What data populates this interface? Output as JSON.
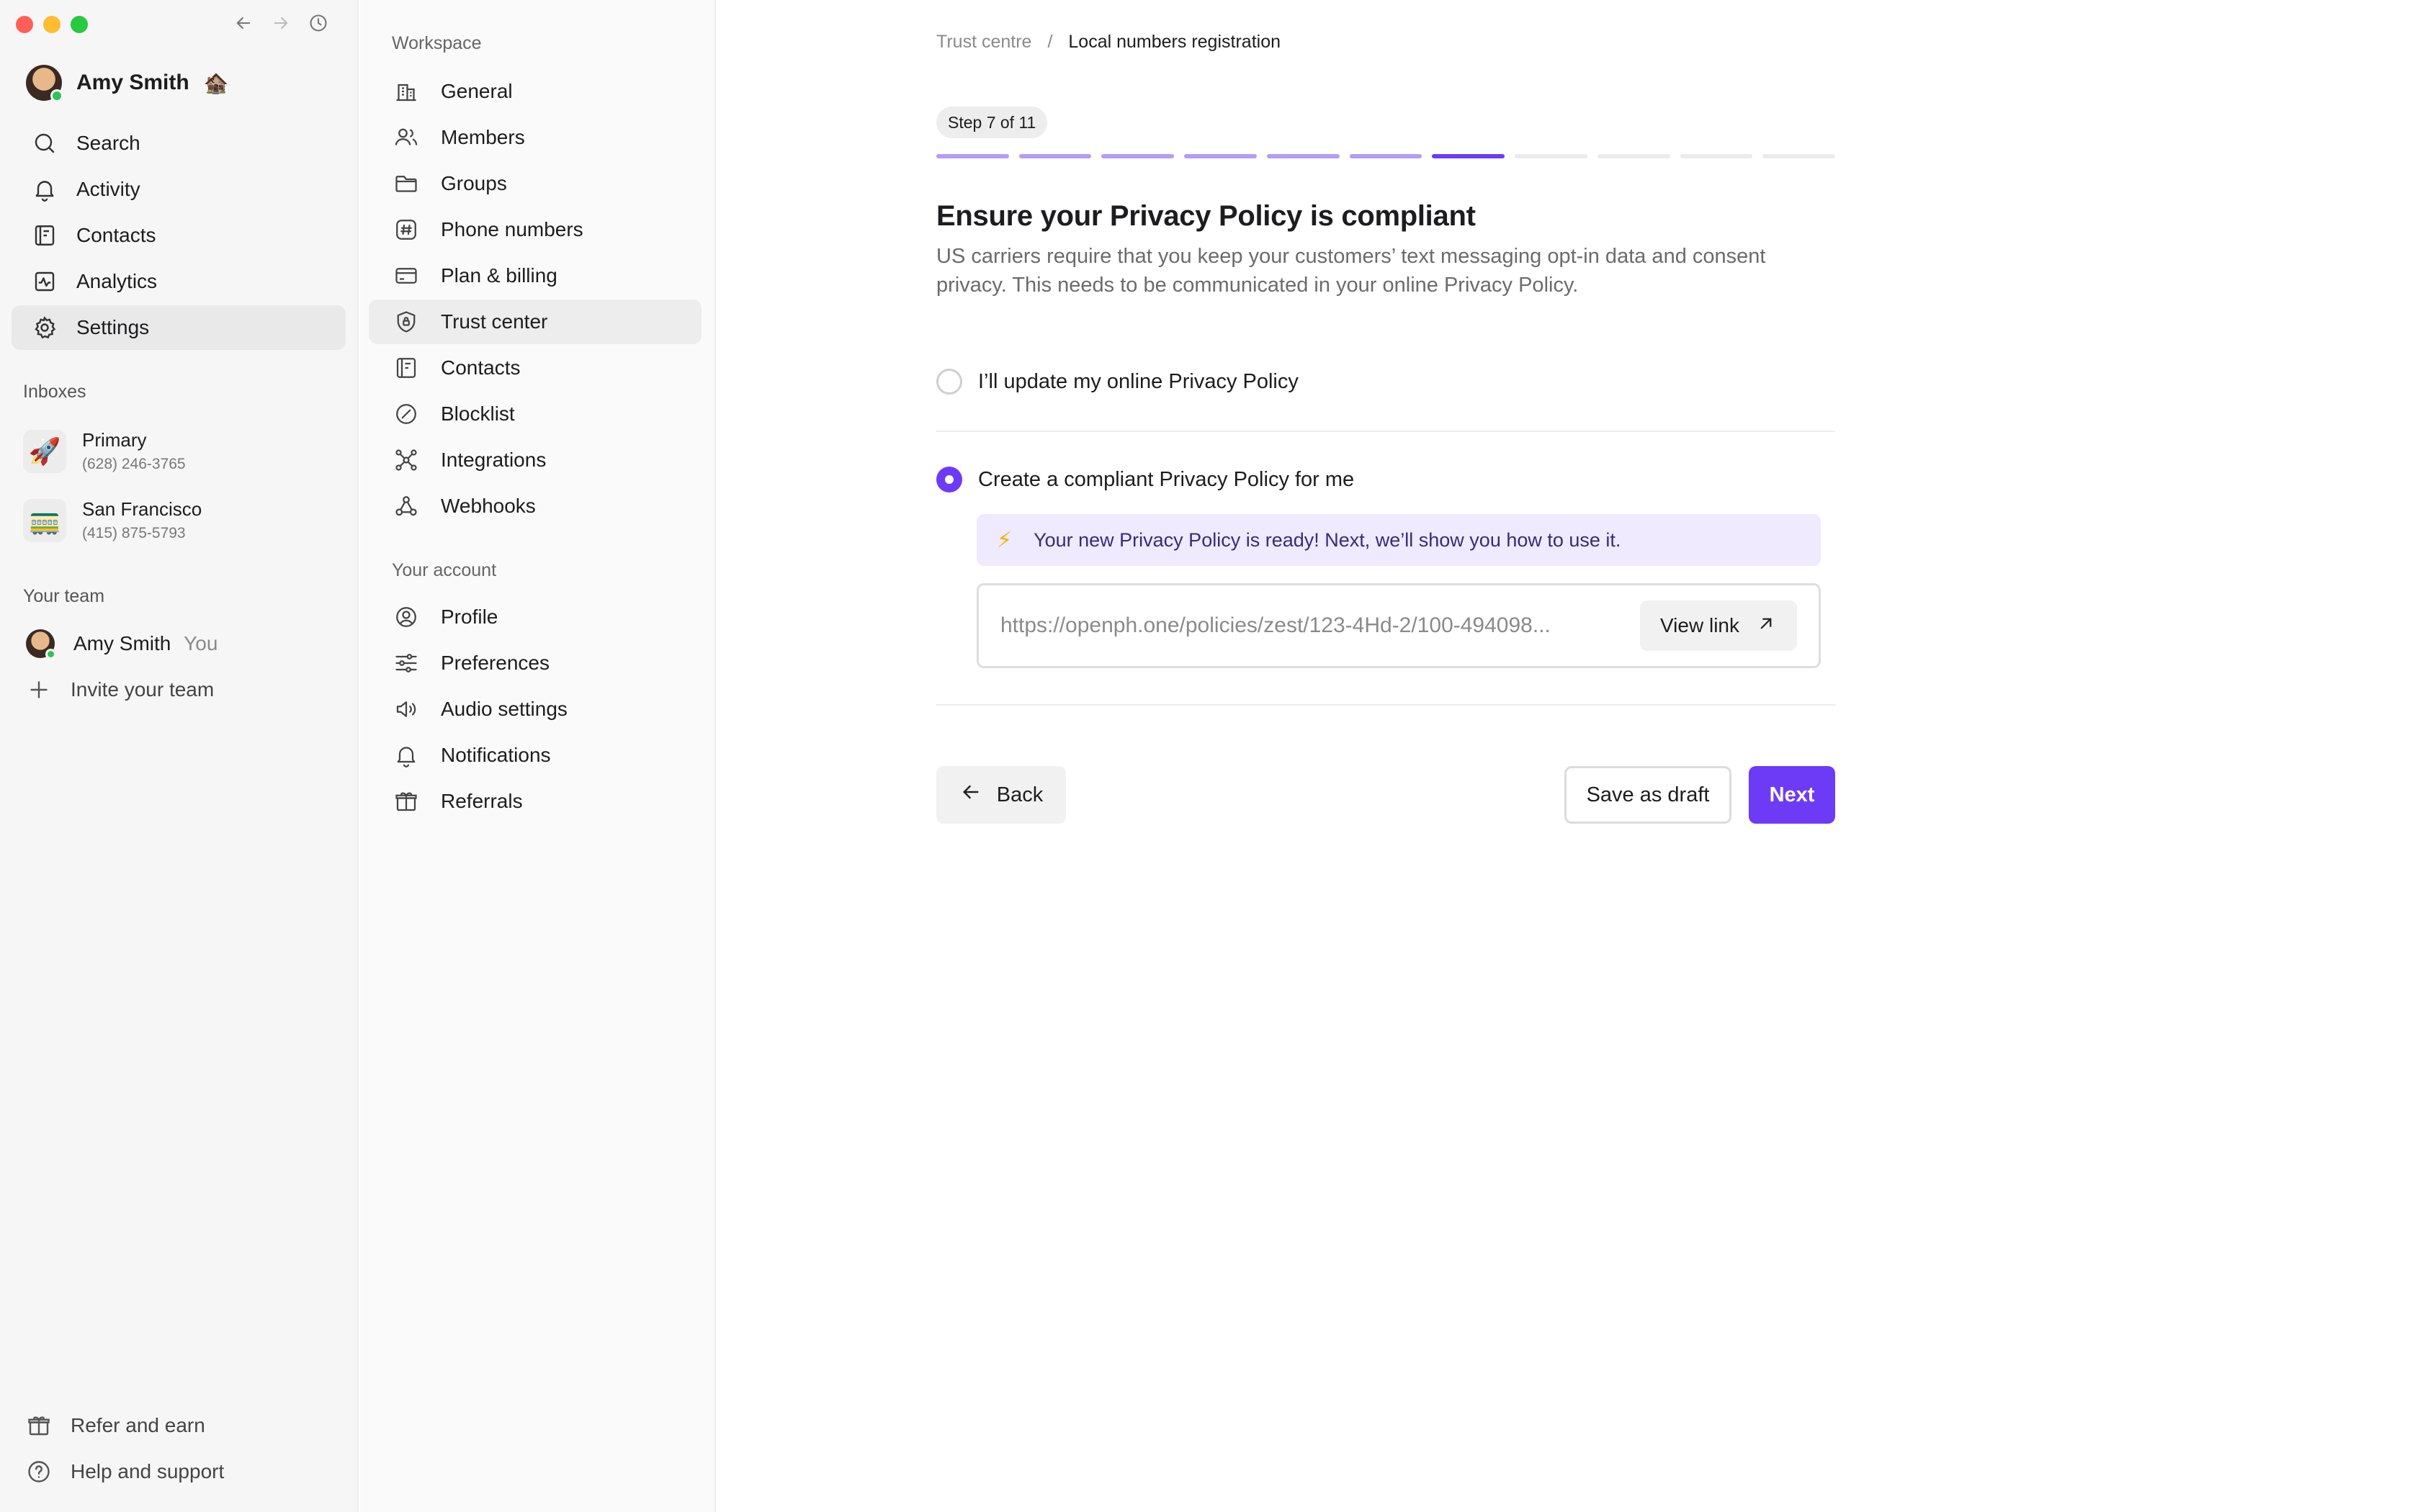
{
  "window": {
    "controls": [
      "close",
      "minimize",
      "zoom"
    ]
  },
  "user": {
    "name": "Amy Smith",
    "emoji": "🏚️"
  },
  "sidebar": {
    "nav": [
      {
        "label": "Search",
        "icon": "search-icon"
      },
      {
        "label": "Activity",
        "icon": "bell-icon"
      },
      {
        "label": "Contacts",
        "icon": "contacts-icon"
      },
      {
        "label": "Analytics",
        "icon": "analytics-icon"
      },
      {
        "label": "Settings",
        "icon": "gear-icon",
        "active": true
      }
    ],
    "inboxes_label": "Inboxes",
    "inboxes": [
      {
        "name": "Primary",
        "phone": "(628) 246-3765",
        "emoji": "🚀"
      },
      {
        "name": "San Francisco",
        "phone": "(415) 875-5793",
        "emoji": "🚃"
      }
    ],
    "team_label": "Your team",
    "team_member": {
      "name": "Amy Smith",
      "tag": "You"
    },
    "invite_label": "Invite your team",
    "footer": [
      {
        "label": "Refer and earn",
        "icon": "gift-icon"
      },
      {
        "label": "Help and support",
        "icon": "help-icon"
      }
    ]
  },
  "subnav": {
    "workspace_label": "Workspace",
    "workspace": [
      {
        "label": "General",
        "icon": "building-icon"
      },
      {
        "label": "Members",
        "icon": "members-icon"
      },
      {
        "label": "Groups",
        "icon": "folder-icon"
      },
      {
        "label": "Phone numbers",
        "icon": "hash-icon"
      },
      {
        "label": "Plan & billing",
        "icon": "card-icon"
      },
      {
        "label": "Trust center",
        "icon": "shield-icon",
        "active": true
      },
      {
        "label": "Contacts",
        "icon": "contacts-icon"
      },
      {
        "label": "Blocklist",
        "icon": "block-icon"
      },
      {
        "label": "Integrations",
        "icon": "integrations-icon"
      },
      {
        "label": "Webhooks",
        "icon": "webhooks-icon"
      }
    ],
    "account_label": "Your account",
    "account": [
      {
        "label": "Profile",
        "icon": "profile-icon"
      },
      {
        "label": "Preferences",
        "icon": "sliders-icon"
      },
      {
        "label": "Audio settings",
        "icon": "speaker-icon"
      },
      {
        "label": "Notifications",
        "icon": "bell-icon"
      },
      {
        "label": "Referrals",
        "icon": "gift-icon"
      }
    ]
  },
  "main": {
    "breadcrumb": {
      "parent": "Trust centre",
      "separator": "/",
      "current": "Local numbers registration"
    },
    "step_label": "Step 7 of 11",
    "progress": {
      "total_steps": 11,
      "current_step": 7
    },
    "title": "Ensure your Privacy Policy is compliant",
    "subtitle": "US carriers require that you keep your customers’ text messaging opt-in data and consent privacy. This needs to be communicated in your online Privacy Policy.",
    "options": [
      {
        "label": "I’ll update my online Privacy Policy",
        "selected": false
      },
      {
        "label": "Create a compliant Privacy Policy for me",
        "selected": true
      }
    ],
    "notice": "Your new Privacy Policy is ready! Next, we’ll show you how to use it.",
    "policy_url": "https://openph.one/policies/zest/123-4Hd-2/100-494098...",
    "view_link_label": "View link",
    "back_label": "Back",
    "draft_label": "Save as draft",
    "next_label": "Next",
    "colors": {
      "accent": "#6d3bf5",
      "accent_light": "#b59cf5",
      "notice_bg": "#efeafd"
    }
  }
}
